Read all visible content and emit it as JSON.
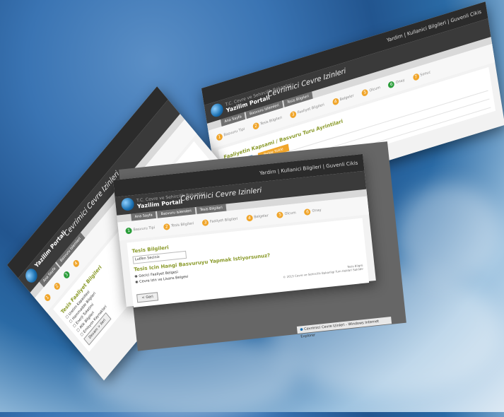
{
  "colors": {
    "accent": "#f0a52a",
    "active": "#2a9d3a",
    "header": "#2b2b2b",
    "title_green": "#8a9a2a"
  },
  "portal": {
    "line1": "T.C. Cevre ve Sehircilik Bakanligi",
    "name": "Yazilim Portali",
    "title": "Cevrimici Cevre Izinleri"
  },
  "topbar": {
    "userlinks": "Yardim  |  Kullanici Bilgileri  |  Guvenli Cikis"
  },
  "tabs": [
    "Ana Sayfa",
    "Basvuru Islemleri",
    "Tesis Bilgileri"
  ],
  "steps": [
    "Basvuru Tipi",
    "Tesis Bilgileri",
    "Faaliyet Bilgileri",
    "Belgeler",
    "Olcum",
    "Onay",
    "Sonuc"
  ],
  "front": {
    "section1": "Tesis Bilgileri",
    "input_value": "Lutfen Seciniz",
    "section2": "Tesis Icin Hangi Basvuruyu Yapmak Istiyorsunuz?",
    "radio1": "Gecici Faaliyet Belgesi",
    "radio2": "Cevre Izin ve Lisans Belgesi",
    "back_btn": "< Geri",
    "footer_line1": "Tesis Bilgisi",
    "footer_line2": "© 2013 Cevre ve Sehircilik Bakanligi Tum Haklari Saklidir",
    "taskbar": "Cevrimici Cevre Izinleri - Windows Internet Explorer"
  },
  "back": {
    "heading": "Faaliyetin Kapsami / Basvuru Turu Ayrintilari",
    "btn_blue": "Bilgi Girisi",
    "btn_orange": "Belge Yukle"
  },
  "left": {
    "heading": "Tesis Faaliyet Bilgileri",
    "items": [
      "Uretim Kapasitesi",
      "Hammadde Bilgileri",
      "Enerji Tuketimi",
      "Atik Bilgileri",
      "Emisyon Kaynaklari"
    ],
    "next_btn": "Devam > Ileri"
  }
}
